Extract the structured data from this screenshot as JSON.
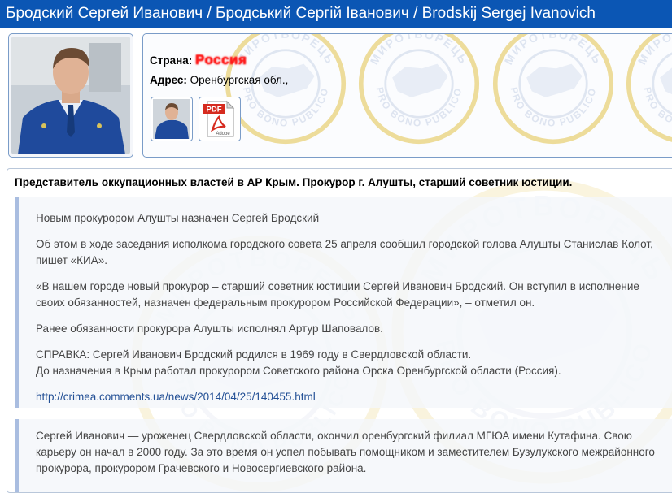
{
  "header": {
    "title": "Бродский Сергей Иванович / Бродський Сергій Іванович / Brodskij Sergej Ivanovich"
  },
  "profile": {
    "country_label": "Страна:",
    "country_value": "Россия",
    "address_label": "Адрес:",
    "address_value": "Оренбургская обл.,",
    "attachments": [
      {
        "type": "photo",
        "icon": "photo-thumbnail"
      },
      {
        "type": "pdf",
        "icon": "pdf-adobe-icon",
        "badge": "PDF",
        "caption": "Adobe"
      }
    ]
  },
  "watermark": {
    "top_text": "МИРОТВОРЕЦЬ",
    "bottom_text": "PRO BONO PUBLICO"
  },
  "content": {
    "summary": "Представитель оккупационных властей в АР Крым. Прокурор г. Алушты, старший советник юстиции.",
    "quote1": {
      "p1": "Новым прокурором Алушты назначен Сергей Бродский",
      "p2": "Об этом в ходе заседания исполкома городского совета 25 апреля сообщил городской голова Алушты Станислав Колот, пишет «КИА».",
      "p3": "«В нашем городе новый прокурор – старший советник юстиции Сергей Иванович Бродский. Он вступил в исполнение своих обязанностей, назначен федеральным прокурором Российской Федерации», – отметил он.",
      "p4": "Ранее обязанности прокурора Алушты исполнял Артур Шаповалов.",
      "p5_line1": "СПРАВКА: Сергей Иванович Бродский родился в 1969 году в Свердловской области.",
      "p5_line2": "До назначения в Крым работал прокурором Советского района Орска Оренбургской области (Россия).",
      "link": "http://crimea.comments.ua/news/2014/04/25/140455.html"
    },
    "quote2": {
      "p1": "Сергей Иванович — уроженец Свердловской области, окончил оренбургский филиал МГЮА имени Кутафина. Свою карьеру он начал в 2000 году. За это время он успел побывать помощником и заместителем Бузулукского межрайонного прокурора, прокурором Грачевского и Новосергиевского района."
    }
  },
  "colors": {
    "header_bg": "#0b56b4",
    "link": "#224f95",
    "quote_bar": "#a9bde0"
  }
}
